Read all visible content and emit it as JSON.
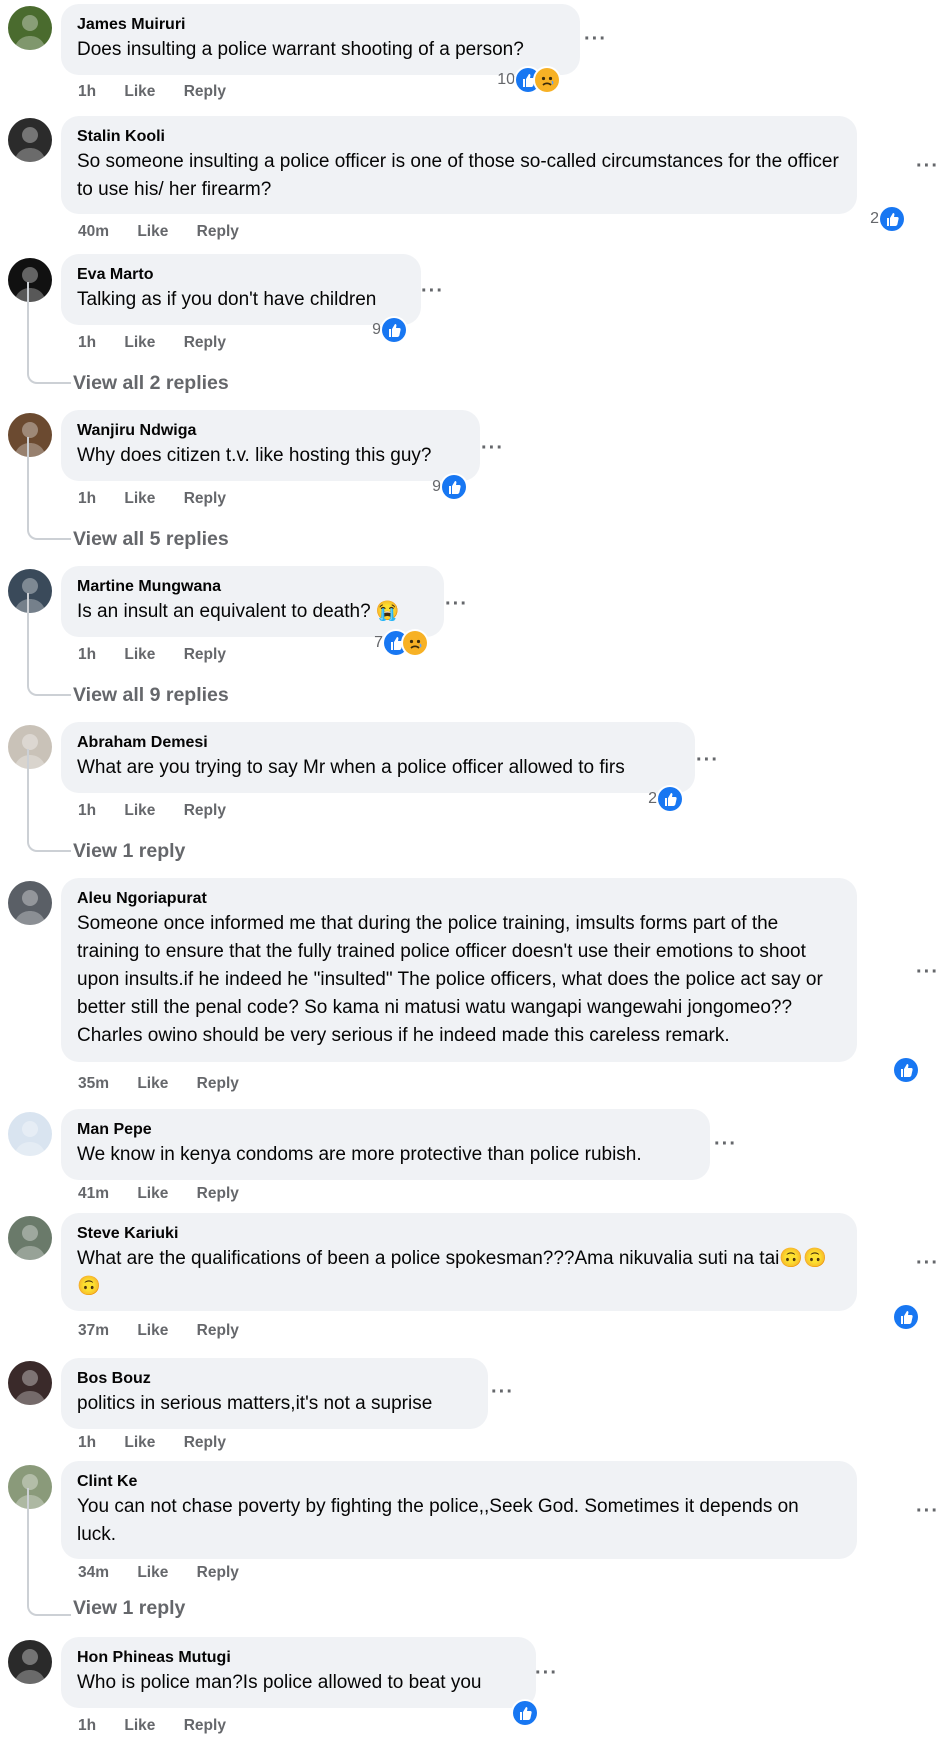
{
  "colors": {
    "like_blue": "#1877f2",
    "sad_yellow": "#f7b125",
    "meta_gray": "#65676b",
    "bubble_bg": "#f0f2f5"
  },
  "comments": [
    {
      "author": "James Muiruri",
      "text": "Does insulting a police warrant shooting of a person?",
      "time": "1h",
      "like": "Like",
      "reply": "Reply",
      "reactions": "10",
      "icons": [
        "like-icon",
        "sad-icon"
      ]
    },
    {
      "author": "Stalin Kooli",
      "text": "So someone insulting a police officer is one of those so-called circumstances for the officer to use his/ her firearm?",
      "time": "40m",
      "like": "Like",
      "reply": "Reply",
      "reactions": "2",
      "icons": [
        "like-icon"
      ]
    },
    {
      "author": "Eva Marto",
      "text": "Talking as if you don't have children",
      "time": "1h",
      "like": "Like",
      "reply": "Reply",
      "reactions": "9",
      "icons": [
        "like-icon"
      ],
      "view_replies": "View all 2 replies"
    },
    {
      "author": "Wanjiru Ndwiga",
      "text": "Why does citizen t.v. like hosting this guy?",
      "time": "1h",
      "like": "Like",
      "reply": "Reply",
      "reactions": "9",
      "icons": [
        "like-icon"
      ],
      "view_replies": "View all 5 replies"
    },
    {
      "author": "Martine Mungwana",
      "text": "Is an insult an equivalent to death? 😭",
      "time": "1h",
      "like": "Like",
      "reply": "Reply",
      "reactions": "7",
      "icons": [
        "like-icon",
        "sad-icon"
      ],
      "view_replies": "View all 9 replies"
    },
    {
      "author": "Abraham Demesi",
      "text": "What are you trying to say Mr when a police officer allowed to firs",
      "time": "1h",
      "like": "Like",
      "reply": "Reply",
      "reactions": "2",
      "icons": [
        "like-icon"
      ],
      "view_replies": "View 1 reply"
    },
    {
      "author": "Aleu Ngoriapurat",
      "text": "Someone once informed me that during the police training, imsults forms part of the training to ensure that the fully trained police officer doesn't use their emotions to shoot upon insults.if he indeed he \"insulted\" The police officers, what does the police act say or better still the penal code? So kama ni matusi watu wangapi wangewahi jongomeo?? Charles owino should be very serious if he indeed made this careless remark.",
      "time": "35m",
      "like": "Like",
      "reply": "Reply",
      "reactions": "",
      "icons": [
        "like-icon"
      ]
    },
    {
      "author": "Man Pepe",
      "text": "We know in kenya condoms are more protective than police rubish.",
      "time": "41m",
      "like": "Like",
      "reply": "Reply",
      "reactions": "",
      "icons": []
    },
    {
      "author": "Steve Kariuki",
      "text": "What are the qualifications of been a police spokesman???Ama nikuvalia suti na tai🙃🙃 🙃",
      "time": "37m",
      "like": "Like",
      "reply": "Reply",
      "reactions": "",
      "icons": [
        "like-icon"
      ]
    },
    {
      "author": "Bos Bouz",
      "text": "politics in serious matters,it's not a suprise",
      "time": "1h",
      "like": "Like",
      "reply": "Reply",
      "reactions": "",
      "icons": []
    },
    {
      "author": "Clint Ke",
      "text": "You can not chase poverty by fighting the police,,Seek God. Sometimes it depends on luck.",
      "time": "34m",
      "like": "Like",
      "reply": "Reply",
      "reactions": "",
      "icons": [],
      "view_replies": "View 1 reply"
    },
    {
      "author": "Hon Phineas Mutugi",
      "text": "Who is police man?Is police allowed to beat you",
      "time": "1h",
      "like": "Like",
      "reply": "Reply",
      "reactions": "",
      "icons": [
        "like-icon"
      ]
    }
  ]
}
